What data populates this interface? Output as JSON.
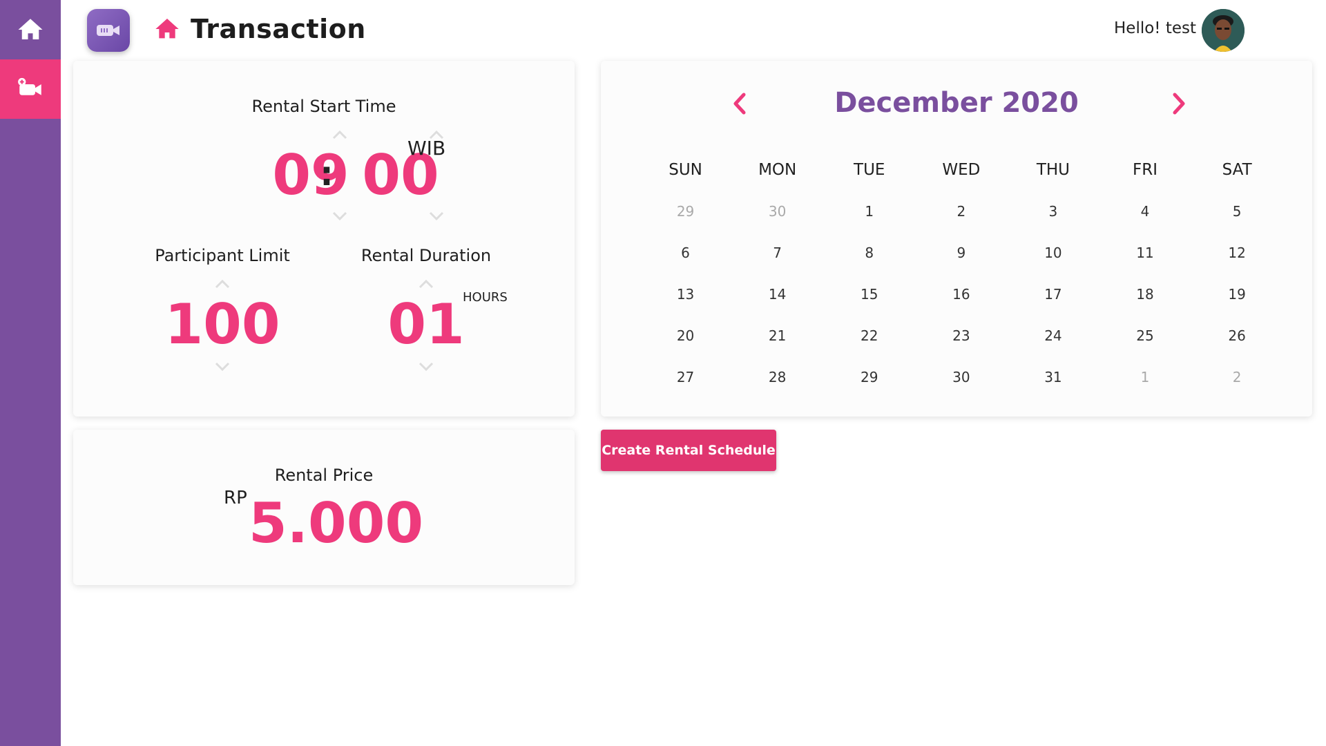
{
  "sidebar": {
    "items": [
      {
        "icon": "home-icon"
      },
      {
        "icon": "add-video-icon",
        "active": true
      }
    ]
  },
  "header": {
    "title": "Transaction",
    "greeting": "Hello! test"
  },
  "rental_start": {
    "label": "Rental Start Time",
    "hour": "09",
    "separator": ":",
    "minute": "00",
    "timezone": "WIB"
  },
  "participant": {
    "label": "Participant Limit",
    "value": "100"
  },
  "duration": {
    "label": "Rental Duration",
    "value": "01",
    "unit": "HOURS"
  },
  "price": {
    "label": "Rental Price",
    "currency": "RP",
    "value": "5.000"
  },
  "calendar": {
    "month_label": "December 2020",
    "weekdays": [
      "SUN",
      "MON",
      "TUE",
      "WED",
      "THU",
      "FRI",
      "SAT"
    ],
    "weeks": [
      [
        "29",
        "30",
        "1",
        "2",
        "3",
        "4",
        "5"
      ],
      [
        "6",
        "7",
        "8",
        "9",
        "10",
        "11",
        "12"
      ],
      [
        "13",
        "14",
        "15",
        "16",
        "17",
        "18",
        "19"
      ],
      [
        "20",
        "21",
        "22",
        "23",
        "24",
        "25",
        "26"
      ],
      [
        "27",
        "28",
        "29",
        "30",
        "31",
        "1",
        "2"
      ]
    ]
  },
  "actions": {
    "create_label": "Create Rental Schedule"
  },
  "colors": {
    "sidebar": "#7a4f9e",
    "accent": "#ee3a7c",
    "month": "#7a4f9e",
    "button": "#e0356f"
  }
}
